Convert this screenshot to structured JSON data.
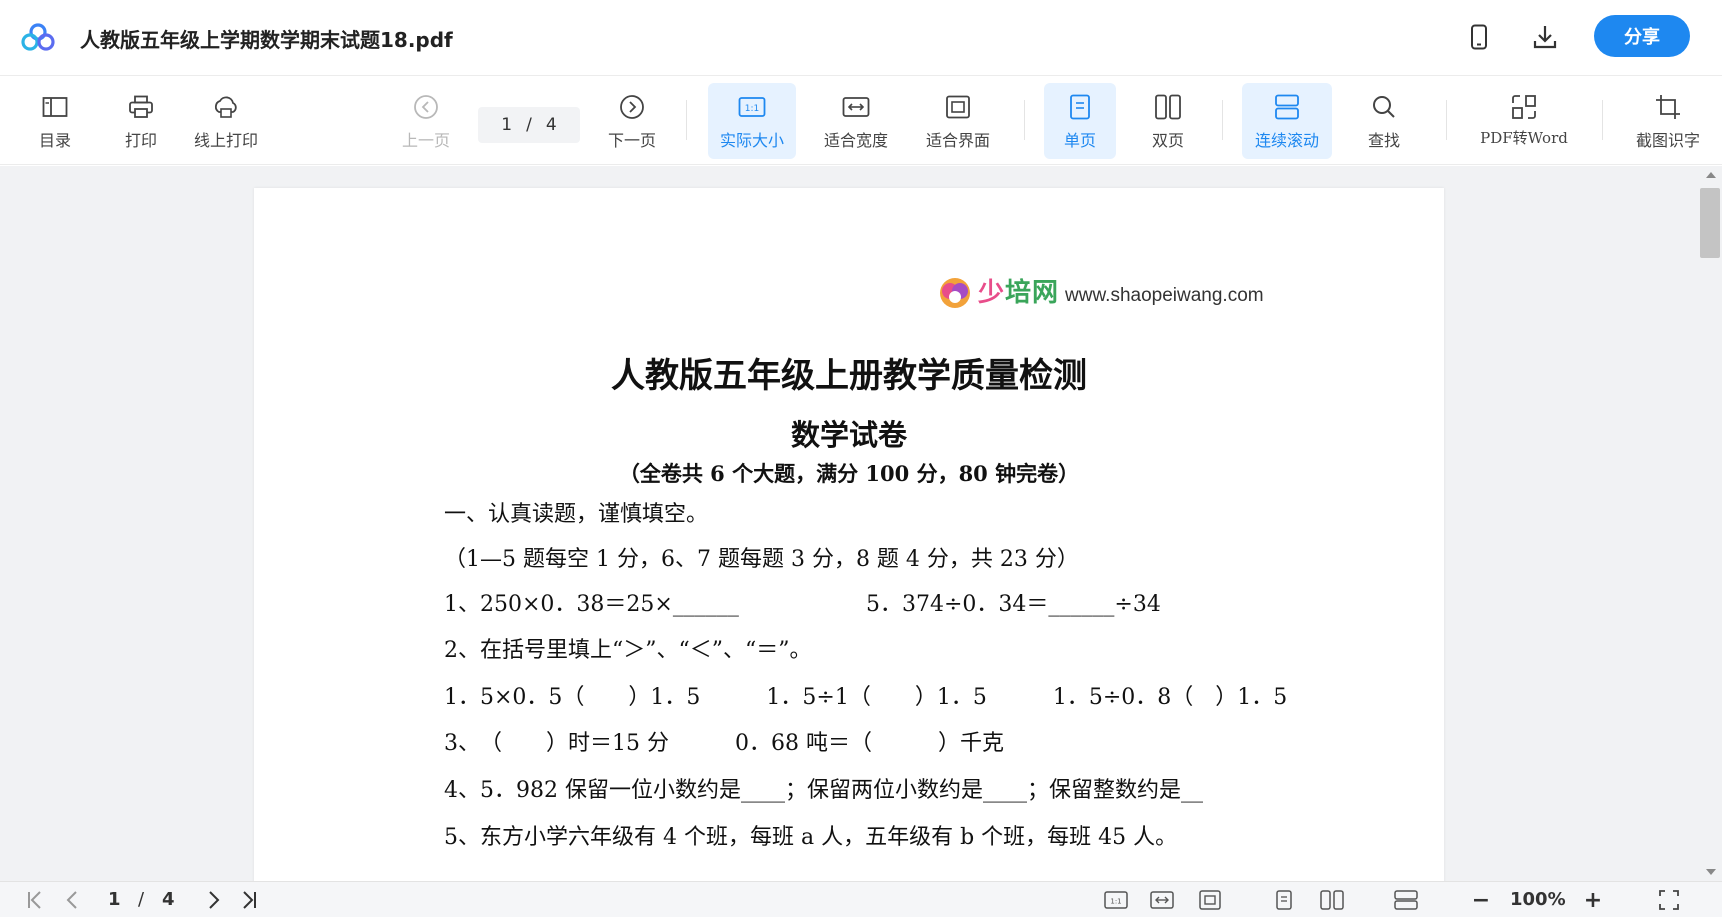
{
  "window": {
    "title": "人教版五年级上学期数学期末试题18.pdf",
    "share_label": "分享",
    "icons": [
      "app-logo-icon",
      "mobile-icon",
      "download-icon"
    ]
  },
  "toolbar": {
    "catalog": "目录",
    "print": "打印",
    "online_print": "线上打印",
    "prev_page": "上一页",
    "current_page": "1",
    "page_sep": "/",
    "total_pages": "4",
    "next_page": "下一页",
    "actual_size": "实际大小",
    "fit_width": "适合宽度",
    "fit_screen": "适合界面",
    "single_page": "单页",
    "double_page": "双页",
    "continuous_scroll": "连续滚动",
    "find": "查找",
    "pdf_to_word": "PDF转Word",
    "screenshot_ocr": "截图识字",
    "accent_color": "#1e88f0"
  },
  "document": {
    "watermark_cn_a": "少",
    "watermark_cn_b": "培",
    "watermark_cn_c": "网",
    "watermark_url": "www.shaopeiwang.com",
    "title": "人教版五年级上册教学质量检测",
    "subtitle": "数学试卷",
    "note": "（全卷共 6 个大题，满分 100 分，80 钟完卷）",
    "lines": [
      "一、认真读题，谨慎填空。",
      "（1—5 题每空 1 分，6、7 题每题 3 分，8 题 4 分，共 23 分）",
      "1、250×0．38＝25×______",
      "5．374÷0．34＝______÷34",
      "2、在括号里填上“＞”、“＜”、“＝”。",
      "1．5×0．5（　　）1．5　　　1．5÷1（　　）1．5　　　1．5÷0．8（　）1．5",
      "3、　（　　）时＝15 分　　　0．68 吨＝（　　　）千克",
      "4、5．982 保留一位小数约是____；保留两位小数约是____；保留整数约是__",
      "5、东方小学六年级有 4 个班，每班 a 人，五年级有 b 个班，每班 45 人。"
    ]
  },
  "statusbar": {
    "current_page": "1",
    "page_sep": "/",
    "total_pages": "4",
    "zoom": "100%",
    "zoom_out": "−",
    "zoom_in": "+"
  }
}
